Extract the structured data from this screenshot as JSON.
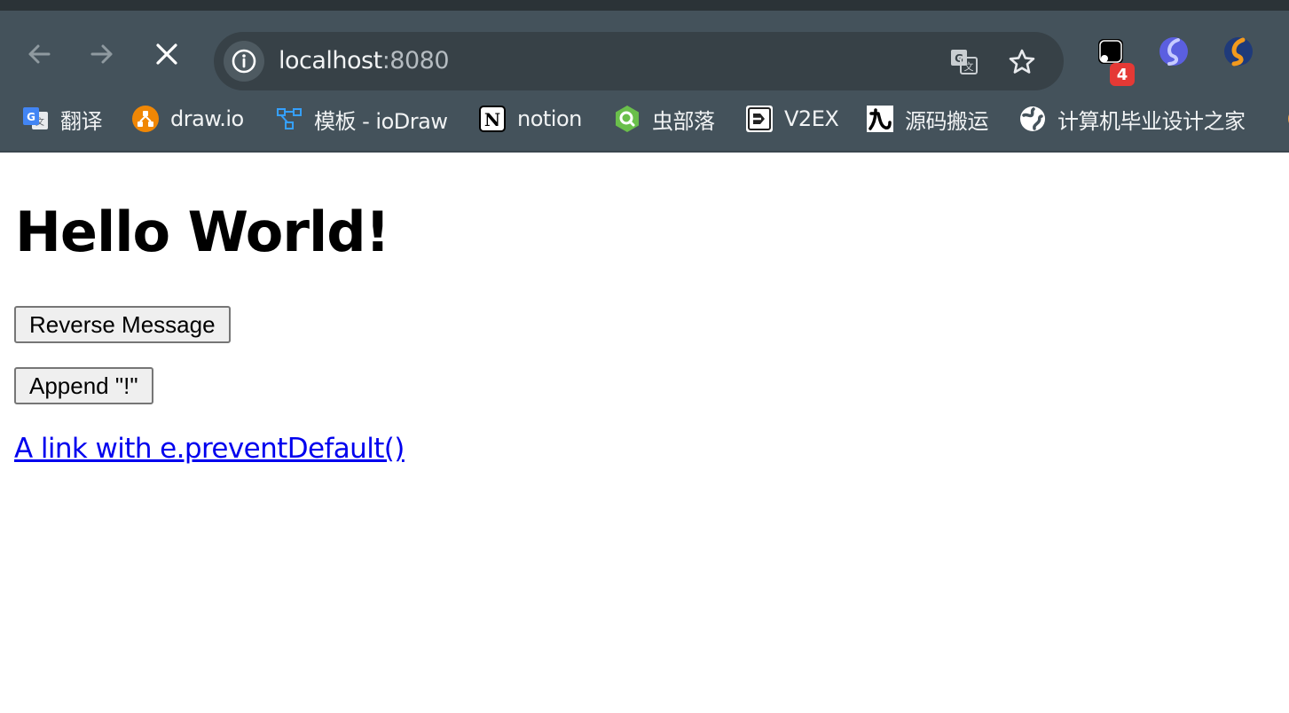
{
  "browser": {
    "nav": {
      "back_icon": "arrow-left-icon",
      "forward_icon": "arrow-right-icon",
      "stop_icon": "close-icon"
    },
    "address_bar": {
      "host": "localhost",
      "port": ":8080",
      "site_info_icon": "info-icon",
      "translate_icon": "google-translate-icon",
      "bookmark_icon": "star-icon"
    },
    "extensions": {
      "badge_count": "4"
    },
    "bookmarks": [
      {
        "label": "翻译",
        "icon": "google-translate-icon"
      },
      {
        "label": "draw.io",
        "icon": "drawio-icon"
      },
      {
        "label": "模板 - ioDraw",
        "icon": "iodraw-icon"
      },
      {
        "label": "notion",
        "icon": "notion-icon"
      },
      {
        "label": "虫部落",
        "icon": "chongbuluo-icon"
      },
      {
        "label": "V2EX",
        "icon": "v2ex-icon"
      },
      {
        "label": "源码搬运",
        "icon": "jiu-icon"
      },
      {
        "label": "计算机毕业设计之家",
        "icon": "globe-icon"
      }
    ]
  },
  "page": {
    "title": "Hello World!",
    "reverse_button": "Reverse Message",
    "append_button": "Append \"!\"",
    "link": "A link with e.preventDefault()"
  },
  "colors": {
    "toolbar": "#44525b",
    "omnibox": "#374147",
    "link": "#0000ee",
    "badge": "#e53935"
  }
}
